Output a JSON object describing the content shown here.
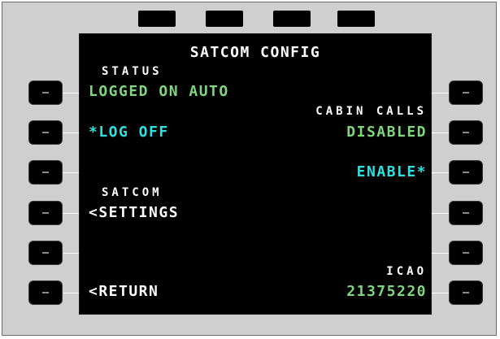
{
  "screen": {
    "title": "SATCOM CONFIG",
    "left": {
      "l1_header": "STATUS",
      "l1_value": "LOGGED ON AUTO",
      "l2_value": "*LOG OFF",
      "l4_header": "SATCOM",
      "l4_value": "<SETTINGS",
      "l6_value": "<RETURN"
    },
    "right": {
      "r2_header": "CABIN CALLS",
      "r2_value": "DISABLED",
      "r3_value": "ENABLE*",
      "r6_header": "ICAO",
      "r6_value": "21375220"
    }
  },
  "colors": {
    "bezel": "#cfcfcf",
    "screen": "#000000",
    "white_text": "#ffffff",
    "green_text": "#7fd67f",
    "cyan_text": "#2fe0e0"
  }
}
